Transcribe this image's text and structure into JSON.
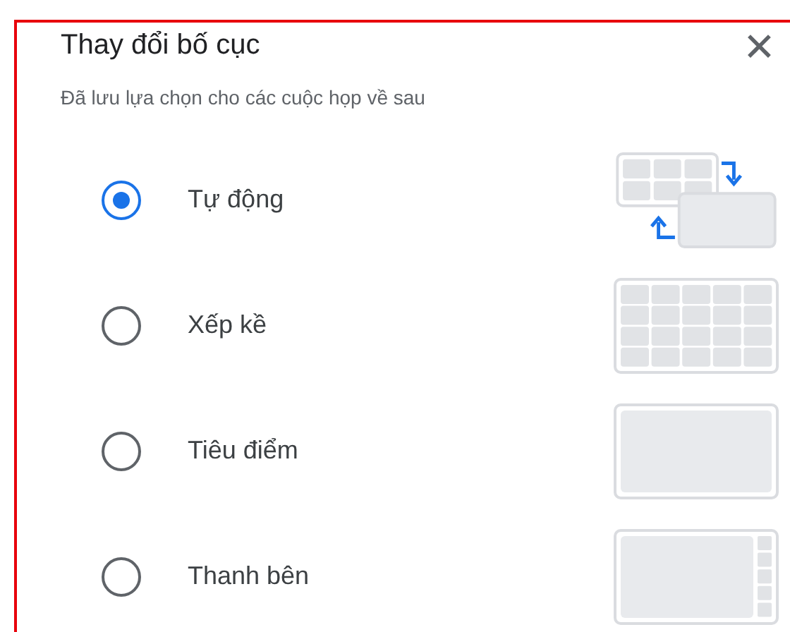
{
  "dialog": {
    "title": "Thay đổi bố cục",
    "subtitle": "Đã lưu lựa chọn cho các cuộc họp về sau",
    "close": "✕"
  },
  "options": [
    {
      "label": "Tự động",
      "selected": true,
      "kind": "auto"
    },
    {
      "label": "Xếp kề",
      "selected": false,
      "kind": "tiled"
    },
    {
      "label": "Tiêu điểm",
      "selected": false,
      "kind": "spotlight"
    },
    {
      "label": "Thanh bên",
      "selected": false,
      "kind": "sidebar"
    }
  ]
}
